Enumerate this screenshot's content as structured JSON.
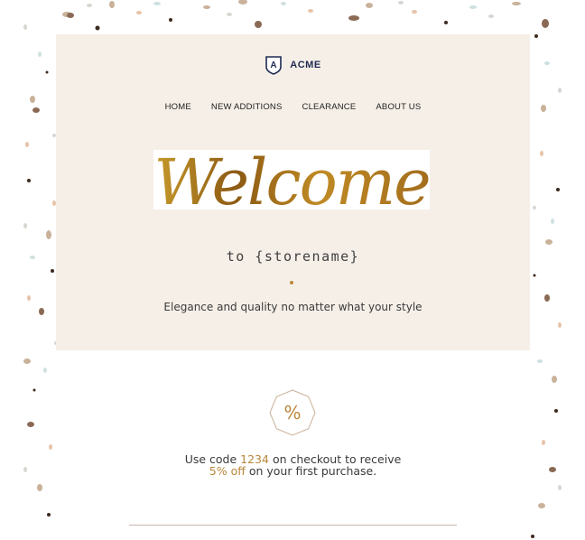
{
  "brand": {
    "name": "ACME",
    "logo_letter": "A"
  },
  "nav": {
    "items": [
      {
        "label": "HOME"
      },
      {
        "label": "NEW ADDITIONS"
      },
      {
        "label": "CLEARANCE"
      },
      {
        "label": "ABOUT US"
      }
    ]
  },
  "hero": {
    "headline": "Welcome",
    "subtitle": "to {storename}",
    "tagline": "Elegance and quality no matter what your style"
  },
  "promo": {
    "badge_symbol": "%",
    "line_prefix": "Use code ",
    "code": "1234",
    "line_middle": " on checkout to receive ",
    "discount": "5% off",
    "line_suffix": " on your first purchase."
  },
  "colors": {
    "card_background": "#f6efe8",
    "accent_gold": "#b9873a",
    "brand_navy": "#1f2b52"
  }
}
